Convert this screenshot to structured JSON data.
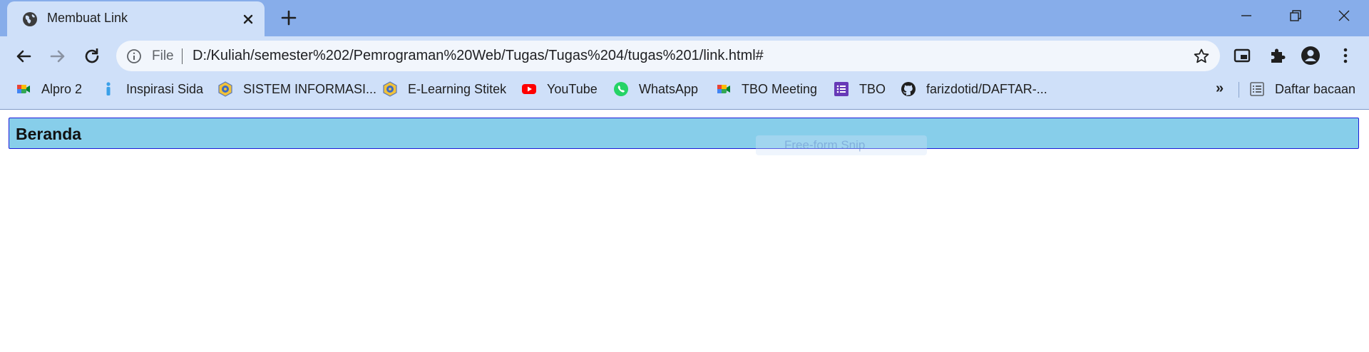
{
  "browser": {
    "tab": {
      "title": "Membuat Link",
      "favicon": "globe-icon"
    },
    "address_bar": {
      "scheme_label": "File",
      "url": "D:/Kuliah/semester%202/Pemrograman%20Web/Tugas/Tugas%204/tugas%201/link.html#"
    },
    "bookmarks": [
      {
        "label": "Alpro 2",
        "icon": "google-meet-icon"
      },
      {
        "label": "Inspirasi Sida",
        "icon": "info-bookmark-icon"
      },
      {
        "label": "SISTEM INFORMASI...",
        "icon": "campus-logo-icon"
      },
      {
        "label": "E-Learning Stitek",
        "icon": "campus-logo-icon"
      },
      {
        "label": "YouTube",
        "icon": "youtube-icon"
      },
      {
        "label": "WhatsApp",
        "icon": "whatsapp-icon"
      },
      {
        "label": "TBO Meeting",
        "icon": "google-meet-icon"
      },
      {
        "label": "TBO",
        "icon": "google-forms-icon"
      },
      {
        "label": "farizdotid/DAFTAR-...",
        "icon": "github-icon"
      }
    ],
    "bookmarks_overflow": "»",
    "reading_list_label": "Daftar bacaan"
  },
  "page": {
    "header_title": "Beranda",
    "snip_overlay_text": "Free-form Snip"
  },
  "colors": {
    "tabstrip": "#87adea",
    "toolbar": "#cfe0f9",
    "header_bg": "#87ceea",
    "header_border": "#1c1cd8"
  }
}
